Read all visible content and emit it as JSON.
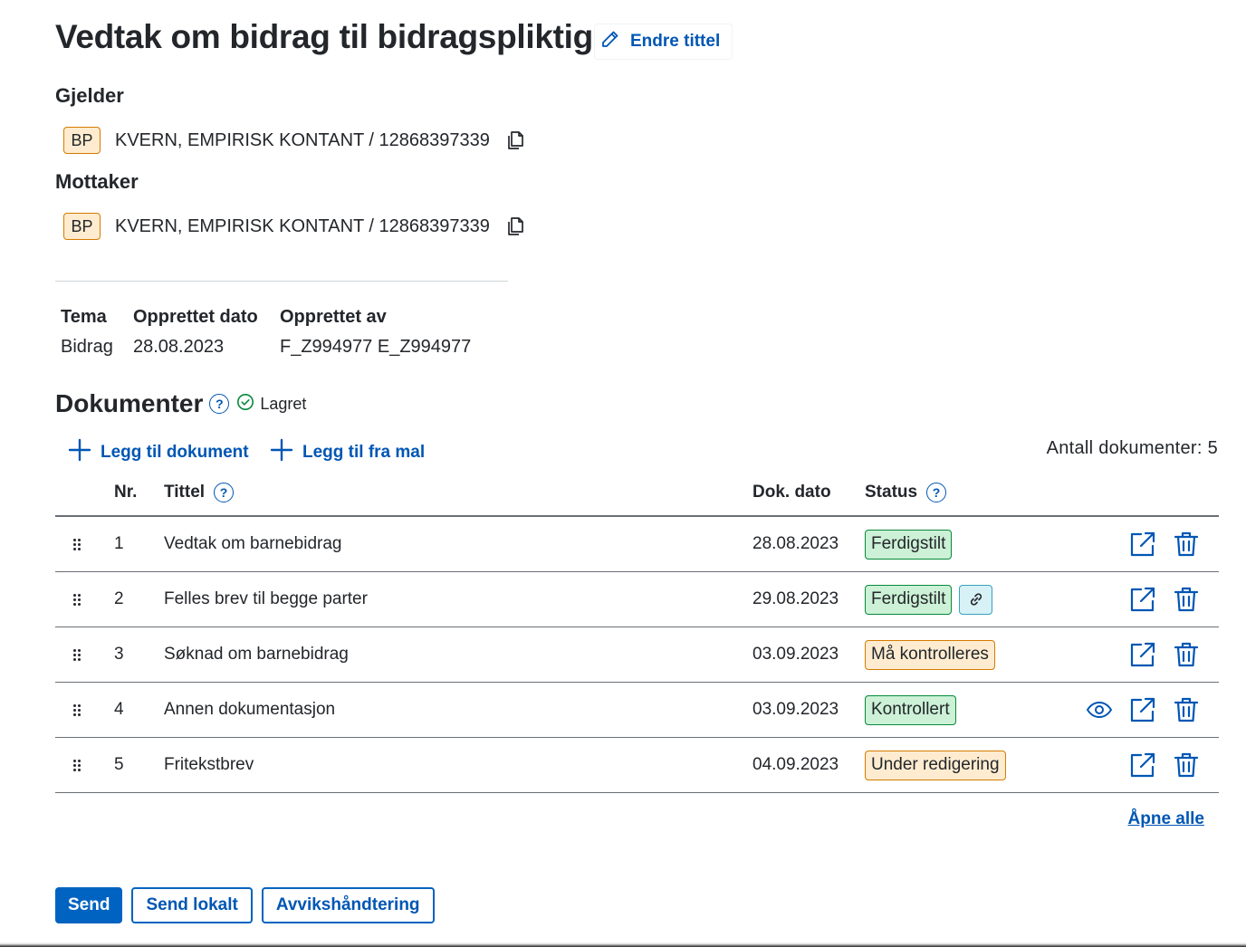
{
  "page": {
    "title": "Vedtak om bidrag til bidragspliktig",
    "edit_title_label": "Endre tittel"
  },
  "gjelder": {
    "label": "Gjelder",
    "role": "BP",
    "person": "KVERN, EMPIRISK KONTANT / 12868397339"
  },
  "mottaker": {
    "label": "Mottaker",
    "role": "BP",
    "person": "KVERN, EMPIRISK KONTANT / 12868397339"
  },
  "meta": {
    "tema_label": "Tema",
    "tema_value": "Bidrag",
    "opprettet_dato_label": "Opprettet dato",
    "opprettet_dato_value": "28.08.2023",
    "opprettet_av_label": "Opprettet av",
    "opprettet_av_value": "F_Z994977 E_Z994977"
  },
  "documents": {
    "heading": "Dokumenter",
    "help": "?",
    "saved_label": "Lagret",
    "add_document_label": "Legg til dokument",
    "add_template_label": "Legg til fra mal",
    "count_label": "Antall dokumenter: 5",
    "columns": {
      "nr": "Nr.",
      "title": "Tittel",
      "date": "Dok. dato",
      "status": "Status"
    },
    "rows": [
      {
        "nr": "1",
        "title": "Vedtak om barnebidrag",
        "date": "28.08.2023",
        "status": "Ferdigstilt",
        "status_color": "#ccf1d6",
        "linked": false,
        "preview": false
      },
      {
        "nr": "2",
        "title": "Felles brev til begge parter",
        "date": "29.08.2023",
        "status": "Ferdigstilt",
        "status_color": "#ccf1d6",
        "linked": true,
        "preview": false
      },
      {
        "nr": "3",
        "title": "Søknad om barnebidrag",
        "date": "03.09.2023",
        "status": "Må kontrolleres",
        "status_color": "#ffecd0",
        "linked": false,
        "preview": false
      },
      {
        "nr": "4",
        "title": "Annen dokumentasjon",
        "date": "03.09.2023",
        "status": "Kontrollert",
        "status_color": "#ccf1d6",
        "linked": false,
        "preview": true
      },
      {
        "nr": "5",
        "title": "Fritekstbrev",
        "date": "04.09.2023",
        "status": "Under redigering",
        "status_color": "#ffecd0",
        "linked": false,
        "preview": false
      }
    ],
    "open_all_label": "Åpne alle"
  },
  "actions": {
    "send_label": "Send",
    "send_local_label": "Send lokalt",
    "deviation_label": "Avvikshåndtering"
  },
  "icons": {
    "edit": "pencil-icon",
    "copy": "copy-icon",
    "help": "question-circle-icon",
    "saved": "check-circle-icon",
    "add": "plus-icon",
    "drag": "drag-handle-icon",
    "link": "link-icon",
    "preview": "eye-icon",
    "open": "external-link-icon",
    "delete": "trash-icon"
  },
  "colors": {
    "accent": "#0063c1",
    "link_text": "#0056b4",
    "status_green": "#ccf1d6",
    "status_orange": "#ffecd0",
    "link_tag": "#d7f1f6"
  }
}
